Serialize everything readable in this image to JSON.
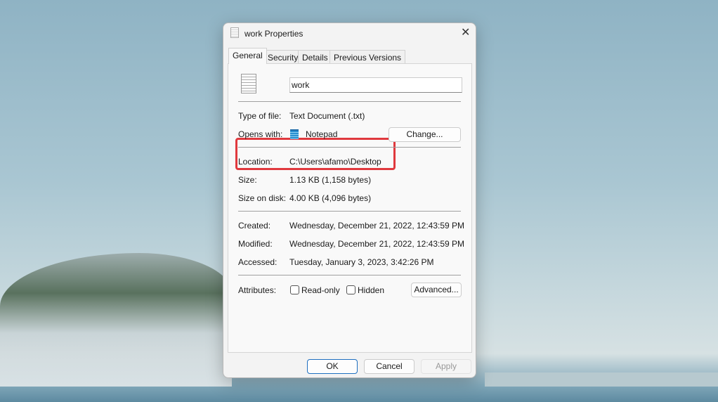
{
  "window": {
    "title": "work Properties",
    "close_icon": "close-icon"
  },
  "tabs": [
    {
      "label": "General",
      "active": true
    },
    {
      "label": "Security"
    },
    {
      "label": "Details"
    },
    {
      "label": "Previous Versions"
    }
  ],
  "general": {
    "filename": "work",
    "type_label": "Type of file:",
    "type_value": "Text Document (.txt)",
    "opens_label": "Opens with:",
    "opens_value": "Notepad",
    "change_label": "Change...",
    "location_label": "Location:",
    "location_value": "C:\\Users\\afamo\\Desktop",
    "size_label": "Size:",
    "size_value": "1.13 KB (1,158 bytes)",
    "disk_label": "Size on disk:",
    "disk_value": "4.00 KB (4,096 bytes)",
    "created_label": "Created:",
    "created_value": "Wednesday, December 21, 2022, 12:43:59 PM",
    "modified_label": "Modified:",
    "modified_value": "Wednesday, December 21, 2022, 12:43:59 PM",
    "accessed_label": "Accessed:",
    "accessed_value": "Tuesday, January 3, 2023, 3:42:26 PM",
    "attributes_label": "Attributes:",
    "readonly_label": "Read-only",
    "readonly_checked": false,
    "hidden_label": "Hidden",
    "hidden_checked": false,
    "advanced_label": "Advanced..."
  },
  "footer": {
    "ok": "OK",
    "cancel": "Cancel",
    "apply": "Apply"
  },
  "highlight_color": "#e0393e"
}
